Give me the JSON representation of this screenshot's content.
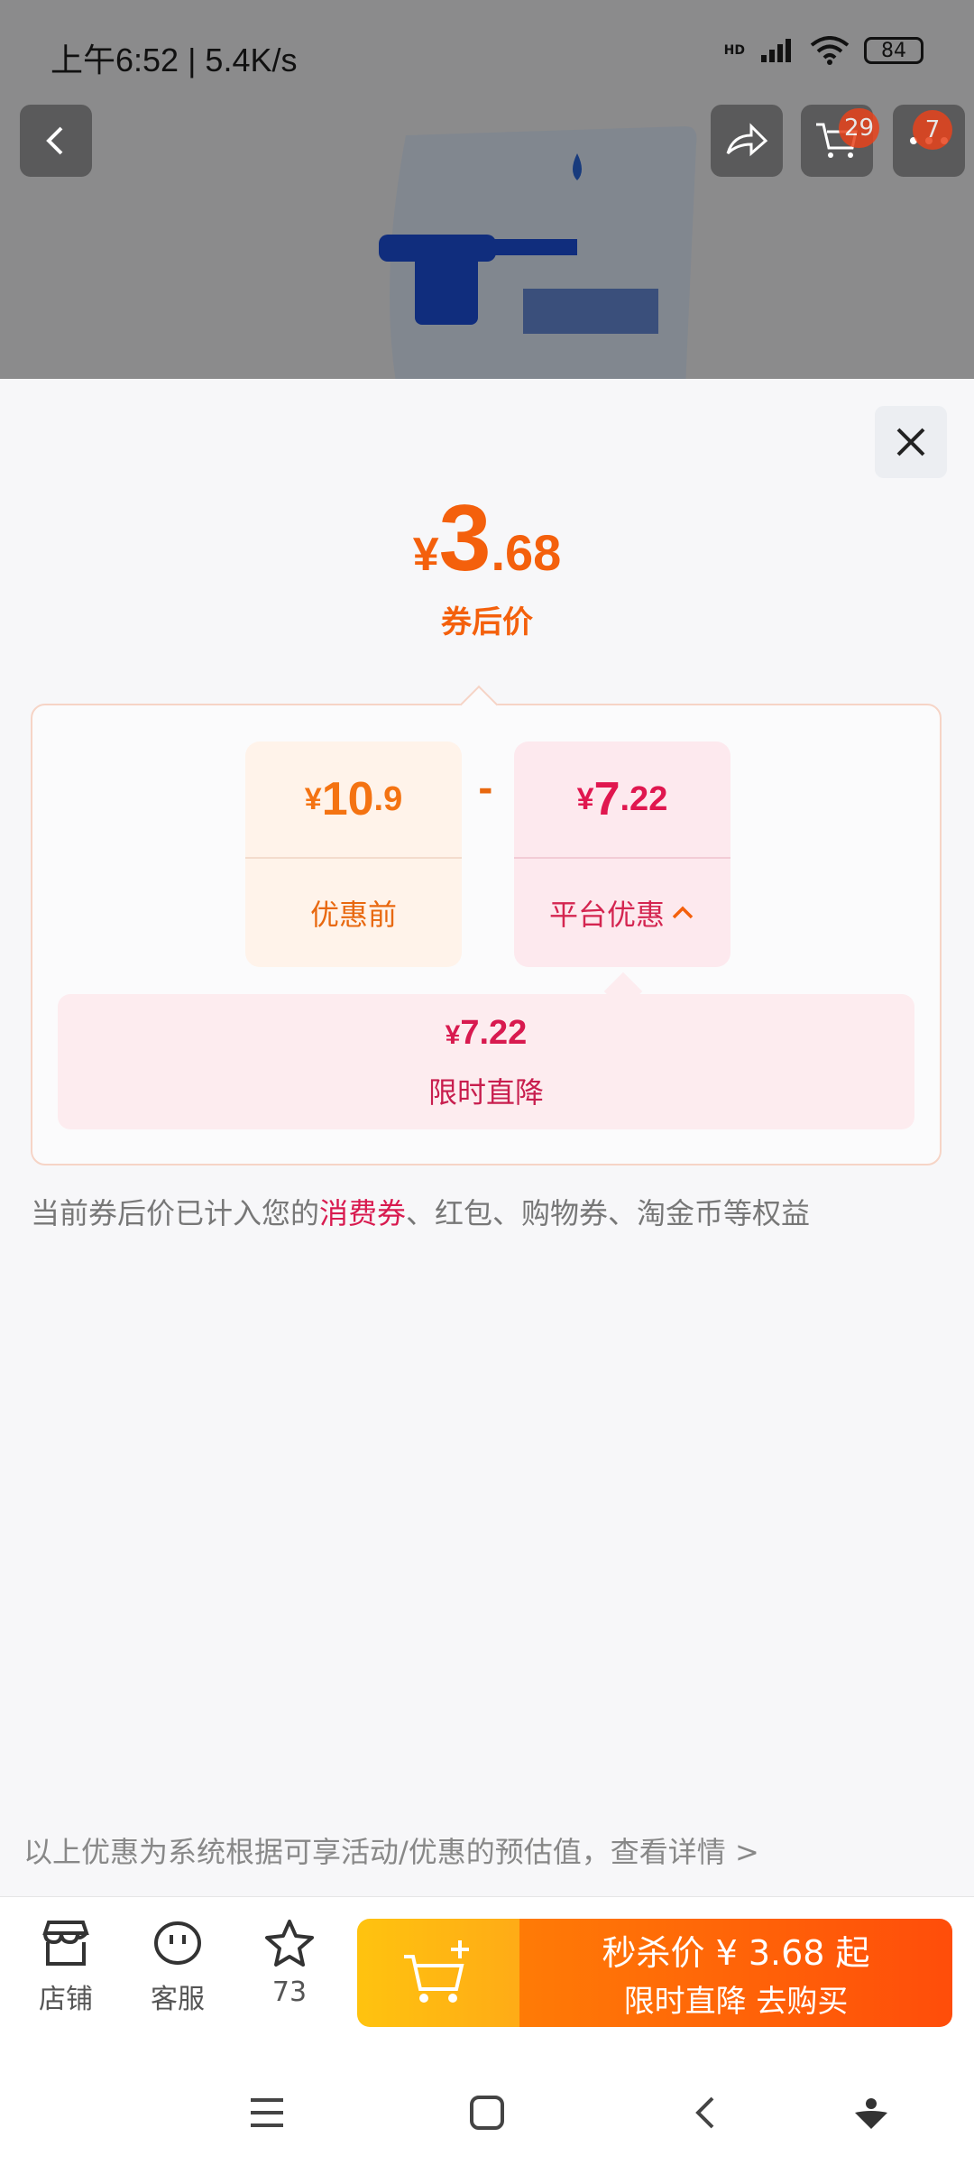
{
  "status_bar": {
    "time_speed": "上午6:52 | 5.4K/s",
    "battery": "84",
    "network_tag": "HD"
  },
  "top_bar": {
    "cart_count": "29",
    "more_count": "7"
  },
  "price_sheet": {
    "final_price": {
      "currency": "¥",
      "integer": "3",
      "decimal": ".68"
    },
    "final_label": "券后价",
    "original": {
      "currency": "¥",
      "integer": "10",
      "decimal": ".9",
      "label": "优惠前"
    },
    "minus": "-",
    "platform": {
      "currency": "¥",
      "integer": "7",
      "decimal": ".22",
      "label": "平台优惠"
    },
    "limited_drop": {
      "currency": "¥",
      "value": "7.22",
      "label": "限时直降"
    },
    "note_prefix": "当前券后价已计入您的",
    "note_highlight": "消费券",
    "note_suffix": "、红包、购物券、淘金币等权益",
    "disclaimer": "以上优惠为系统根据可享活动/优惠的预估值，查看详情 >"
  },
  "bottom_bar": {
    "shop_label": "店铺",
    "service_label": "客服",
    "fav_count": "73",
    "buy_line1": "秒杀价 ¥ 3.68 起",
    "buy_line2": "限时直降  去购买"
  },
  "colors": {
    "accent_orange": "#f4600c",
    "accent_red": "#e0174f",
    "buy_gradient_start": "#ff7b06",
    "buy_gradient_end": "#ff4d0a"
  }
}
